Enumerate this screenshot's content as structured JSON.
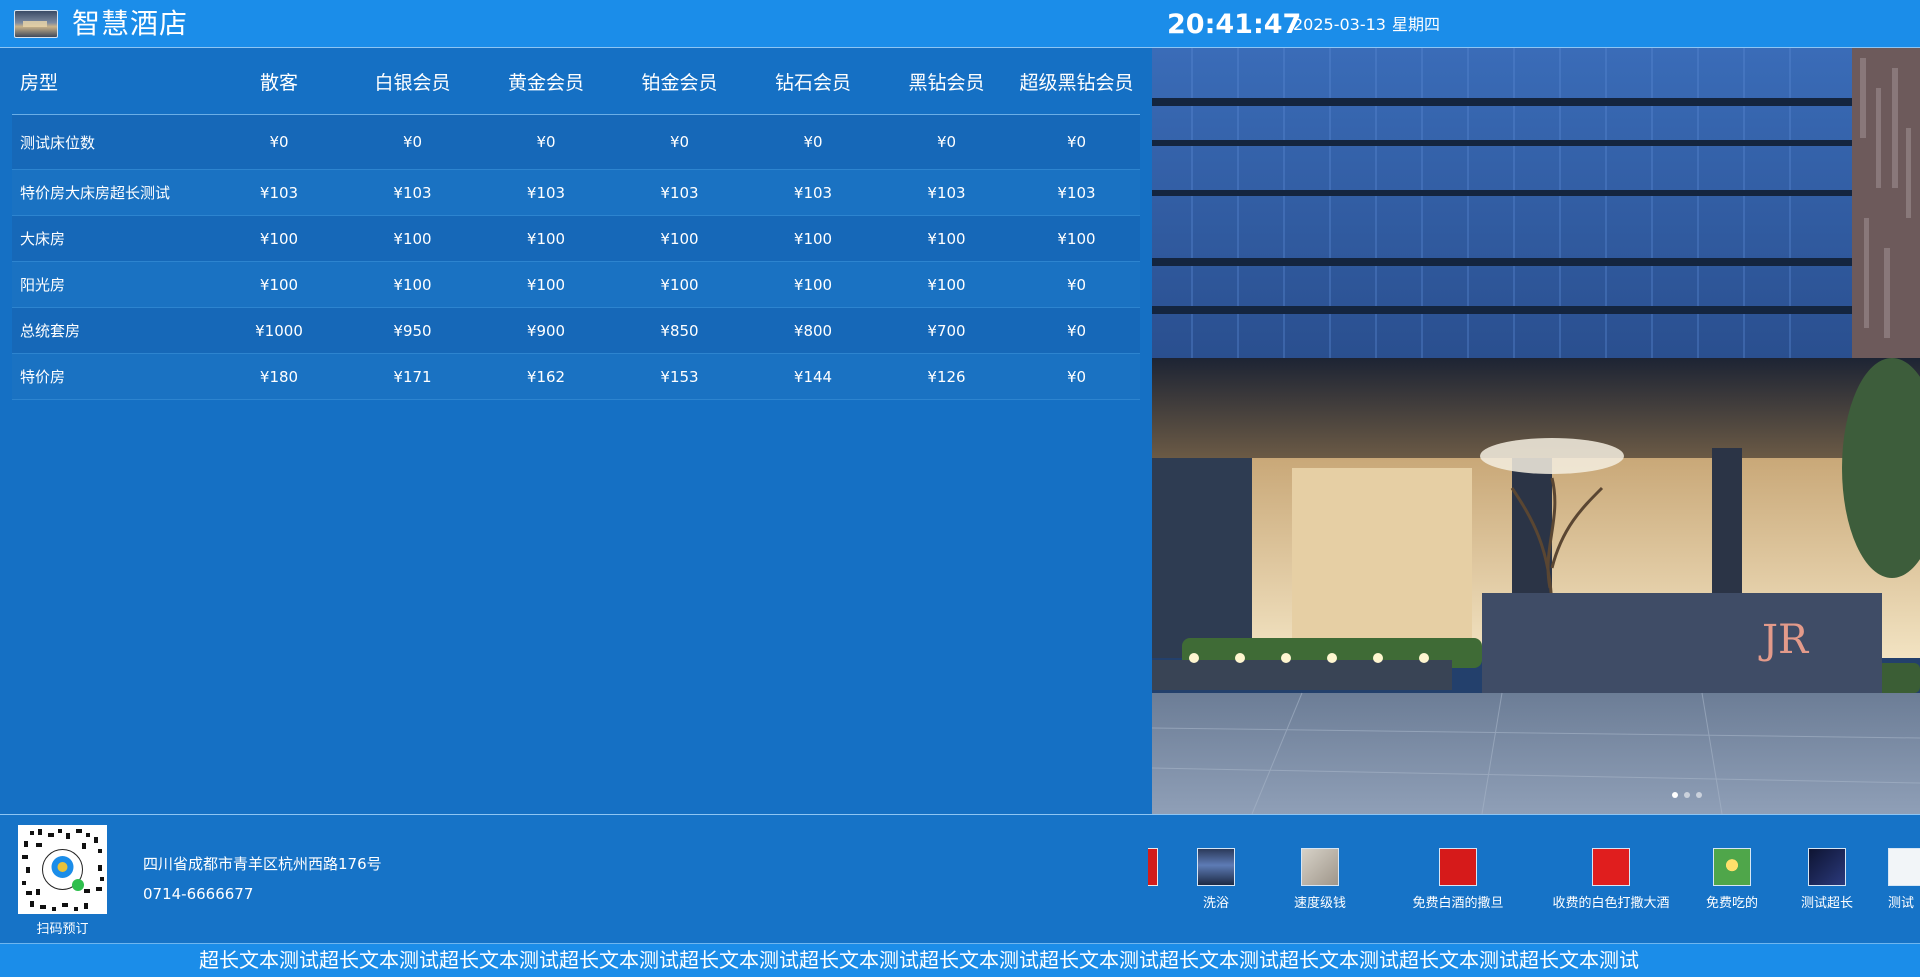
{
  "header": {
    "hotel_name": "智慧酒店",
    "time": "20:41:47",
    "date": "2025-03-13",
    "weekday": "星期四"
  },
  "price_table": {
    "columns": [
      "房型",
      "散客",
      "白银会员",
      "黄金会员",
      "铂金会员",
      "钻石会员",
      "黑钻会员",
      "超级黑钻会员"
    ],
    "rows": [
      [
        "测试床位数",
        "¥0",
        "¥0",
        "¥0",
        "¥0",
        "¥0",
        "¥0",
        "¥0"
      ],
      [
        "特价房大床房超长测试",
        "¥103",
        "¥103",
        "¥103",
        "¥103",
        "¥103",
        "¥103",
        "¥103"
      ],
      [
        "大床房",
        "¥100",
        "¥100",
        "¥100",
        "¥100",
        "¥100",
        "¥100",
        "¥100"
      ],
      [
        "阳光房",
        "¥100",
        "¥100",
        "¥100",
        "¥100",
        "¥100",
        "¥100",
        "¥0"
      ],
      [
        "总统套房",
        "¥1000",
        "¥950",
        "¥900",
        "¥850",
        "¥800",
        "¥700",
        "¥0"
      ],
      [
        "特价房",
        "¥180",
        "¥171",
        "¥162",
        "¥153",
        "¥144",
        "¥126",
        "¥0"
      ]
    ]
  },
  "carousel": {
    "slide_count": 3,
    "active_index": 0,
    "sign_text": "JR"
  },
  "footer": {
    "qr_label": "扫码预订",
    "address": "四川省成都市青羊区杭州西路176号",
    "phone": "0714-6666677",
    "services": [
      {
        "label": "洗浴",
        "icon": "bath-thumbnail"
      },
      {
        "label": "速度级钱",
        "icon": "room-thumbnail"
      },
      {
        "label": "免费白酒的撒旦",
        "icon": "red-poster-thumbnail"
      },
      {
        "label": "收费的白色打撒大酒",
        "icon": "red-poster-thumbnail"
      },
      {
        "label": "免费吃的",
        "icon": "green-food-thumbnail"
      },
      {
        "label": "测试超长",
        "icon": "dark-night-thumbnail"
      },
      {
        "label": "测试",
        "icon": "blank-thumbnail"
      }
    ]
  },
  "marquee": {
    "text": "超长文本测试超长文本测试超长文本测试超长文本测试超长文本测试超长文本测试超长文本测试超长文本测试超长文本测试超长文本测试超长文本测试超长文本测试"
  },
  "colors": {
    "background": "#1570c4",
    "header": "#1b8de9",
    "table_row_odd": "#1668b8",
    "table_row_even": "#1a72c2"
  }
}
